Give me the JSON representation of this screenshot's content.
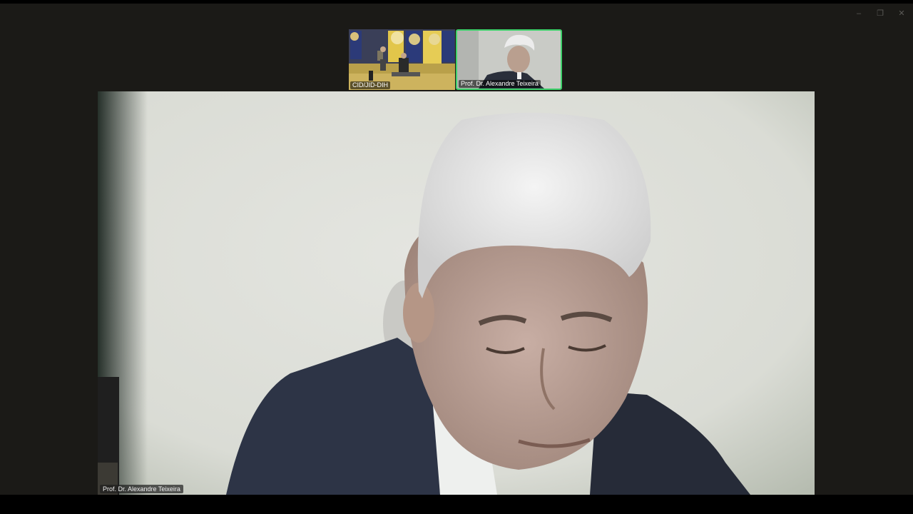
{
  "window_controls": {
    "minimize": "–",
    "maximize": "❐",
    "close": "✕"
  },
  "gallery": {
    "thumbnails": [
      {
        "label": "CID/JID-DIH"
      },
      {
        "label": "Prof. Dr. Alexandre Teixeira",
        "active_speaker": true
      }
    ]
  },
  "main_video": {
    "participant_label": "Prof. Dr. Alexandre Teixeira"
  },
  "colors": {
    "active_speaker_border": "#3ed16b",
    "window_background": "#1b1a17"
  }
}
